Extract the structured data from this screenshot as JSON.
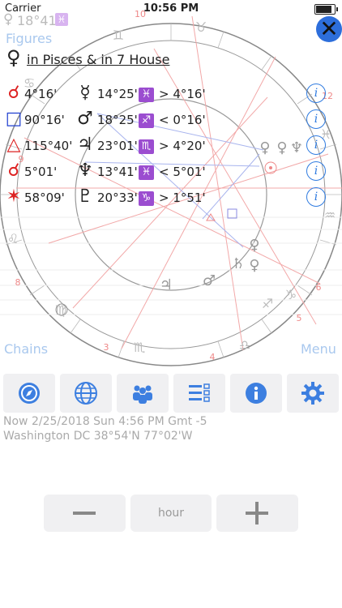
{
  "status": {
    "carrier": "Carrier",
    "time": "10:56 PM"
  },
  "header": {
    "glyph": "♀",
    "degree": "18°41'",
    "sign": "♓"
  },
  "figures_label": "Figures",
  "title": {
    "glyph": "♀",
    "text": "in Pisces & in 7 House"
  },
  "aspects": [
    {
      "aspect": "☌",
      "aspect_color": "#d22",
      "orb": "4°16'",
      "planet": "☿",
      "position": "14°25'",
      "sign": "♓",
      "result": "> 4°16'"
    },
    {
      "aspect": "□",
      "aspect_color": "#1f3fd0",
      "orb": "90°16'",
      "planet": "♂",
      "position": "18°25'",
      "sign": "♐",
      "result": "< 0°16'"
    },
    {
      "aspect": "△",
      "aspect_color": "#d22",
      "orb": "115°40'",
      "planet": "♃",
      "position": "23°01'",
      "sign": "♏",
      "result": "> 4°20'"
    },
    {
      "aspect": "☌",
      "aspect_color": "#d22",
      "orb": "5°01'",
      "planet": "♆",
      "position": "13°41'",
      "sign": "♓",
      "result": "< 5°01'"
    },
    {
      "aspect": "✶",
      "aspect_color": "#d22",
      "orb": "58°09'",
      "planet": "♇",
      "position": "20°33'",
      "sign": "♑",
      "result": "> 1°51'"
    }
  ],
  "wheel": {
    "sign_glyphs": [
      "♊",
      "♉",
      "♋",
      "♌",
      "♍",
      "♏",
      "♎",
      "♐",
      "♑",
      "♒",
      "♓"
    ],
    "house_numbers": [
      "10",
      "12",
      "4",
      "3",
      "5",
      "6",
      "8",
      "9"
    ]
  },
  "nav": {
    "chains": "Chains",
    "menu": "Menu"
  },
  "toolbar": {
    "items": [
      {
        "icon": "compass-icon"
      },
      {
        "icon": "globe-icon"
      },
      {
        "icon": "people-icon"
      },
      {
        "icon": "list-icon"
      },
      {
        "icon": "info-icon"
      },
      {
        "icon": "gear-icon"
      }
    ]
  },
  "info": {
    "line1": "Now 2/25/2018 Sun 4:56 PM Gmt -5",
    "line2": "Washington DC 38°54'N 77°02'W"
  },
  "stepper": {
    "unit": "hour"
  }
}
